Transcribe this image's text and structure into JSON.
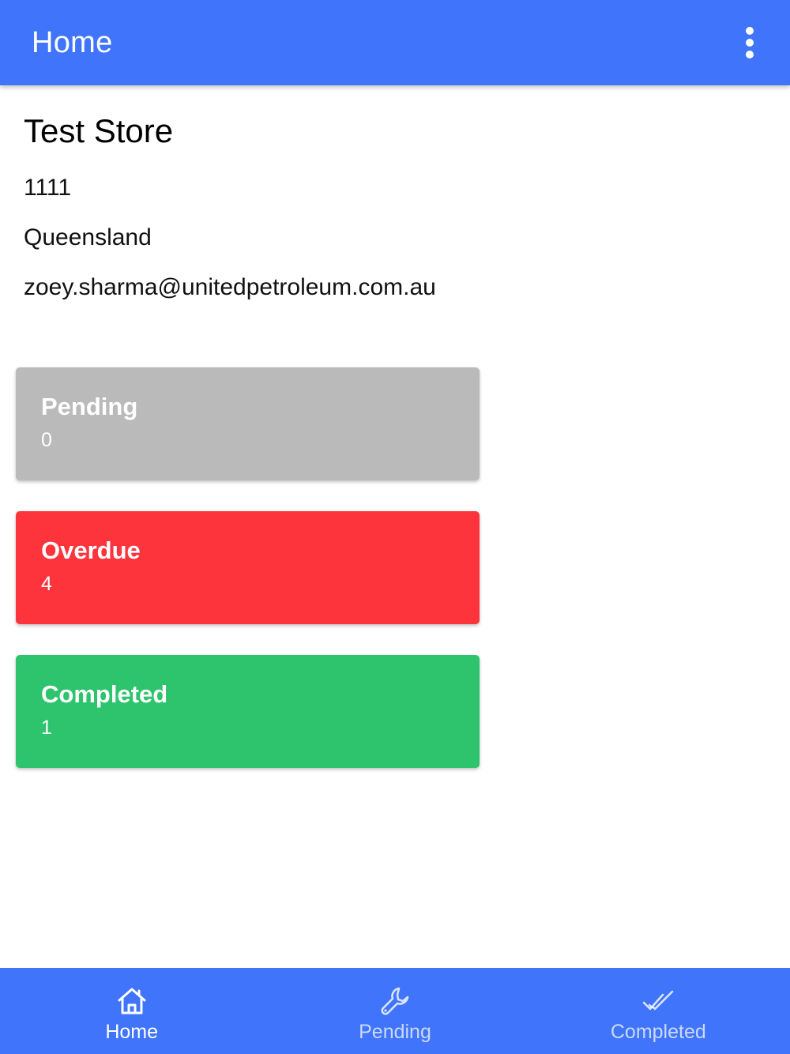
{
  "header": {
    "title": "Home",
    "menu_icon": "more-vertical-icon",
    "background": "#3f74fb"
  },
  "store": {
    "name": "Test Store",
    "code": "1111",
    "state": "Queensland",
    "email": "zoey.sharma@unitedpetroleum.com.au"
  },
  "summary_cards": {
    "pending": {
      "title": "Pending",
      "count": "0",
      "color": "#bababa"
    },
    "overdue": {
      "title": "Overdue",
      "count": "4",
      "color": "#fe343d"
    },
    "completed": {
      "title": "Completed",
      "count": "1",
      "color": "#2ec46d"
    }
  },
  "bottom_nav": {
    "background": "#3f74fb",
    "items": [
      {
        "label": "Home",
        "icon": "home-icon",
        "active": true
      },
      {
        "label": "Pending",
        "icon": "wrench-icon",
        "active": false
      },
      {
        "label": "Completed",
        "icon": "double-check-icon",
        "active": false
      }
    ]
  }
}
